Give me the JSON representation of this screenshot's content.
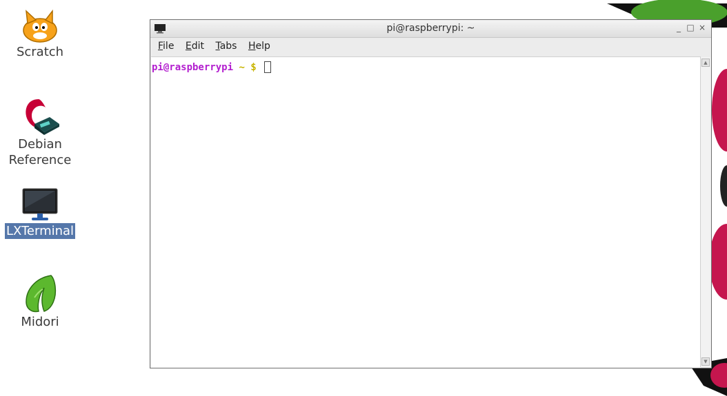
{
  "desktop": {
    "icons": [
      {
        "label": "Scratch",
        "icon": "scratch-cat-icon"
      },
      {
        "label": "Debian Reference",
        "line1": "Debian",
        "line2": "Reference",
        "icon": "debian-reference-icon"
      },
      {
        "label": "LXTerminal",
        "icon": "monitor-icon",
        "selected": true
      },
      {
        "label": "Midori",
        "icon": "midori-leaf-icon"
      }
    ]
  },
  "window": {
    "title": "pi@raspberrypi: ~",
    "controls": {
      "minimize": "_",
      "maximize": "□",
      "close": "×"
    },
    "menus": [
      {
        "label": "File",
        "mnemonic": "F",
        "rest": "ile"
      },
      {
        "label": "Edit",
        "mnemonic": "E",
        "rest": "dit"
      },
      {
        "label": "Tabs",
        "mnemonic": "T",
        "rest": "abs"
      },
      {
        "label": "Help",
        "mnemonic": "H",
        "rest": "elp"
      }
    ],
    "terminal": {
      "user_host": "pi@raspberrypi",
      "path": " ~ $",
      "input": ""
    }
  },
  "colors": {
    "prompt_user": "#b31fcf",
    "prompt_path": "#c8b400",
    "selected_icon_bg": "#5577aa",
    "wallpaper_red": "#c5164e",
    "wallpaper_green": "#4aa02c"
  }
}
